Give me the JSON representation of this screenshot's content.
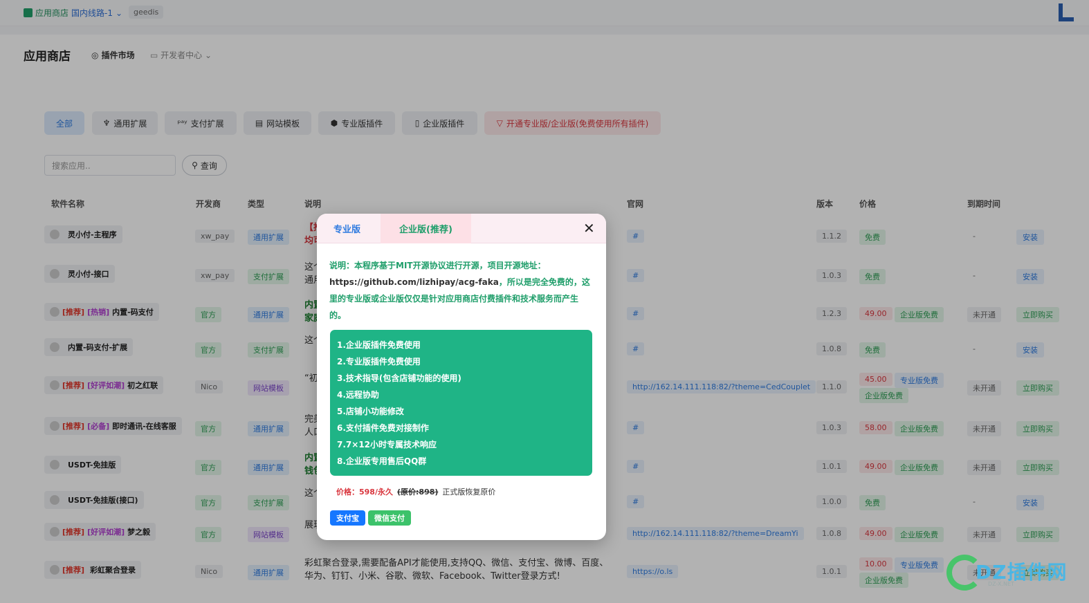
{
  "topbar": {
    "store": "应用商店",
    "route": "国内线路-1",
    "user": "geedis"
  },
  "header": {
    "title": "应用商店",
    "nav_market": "插件市场",
    "nav_dev": "开发者中心"
  },
  "filters": [
    "全部",
    "通用扩展",
    "支付扩展",
    "网站模板",
    "专业版插件",
    "企业版插件",
    "开通专业版/企业版(免费使用所有插件)"
  ],
  "search": {
    "placeholder": "搜索应用..",
    "button": "查询"
  },
  "columns": [
    "软件名称",
    "开发商",
    "类型",
    "说明",
    "官网",
    "版本",
    "价格",
    "到期时间"
  ],
  "rows": [
    {
      "tag1": "",
      "tag2": "",
      "name": "灵小付-主程序",
      "dev": "xw_pay",
      "type": "通用扩展",
      "desc": "【推",
      "desc2": "均可",
      "site": "#",
      "ver": "1.1.2",
      "price": "免费",
      "extra1": "",
      "extra2": "",
      "exp": "-",
      "action": "安装"
    },
    {
      "tag1": "",
      "tag2": "",
      "name": "灵小付-接口",
      "dev": "xw_pay",
      "type": "支付扩展",
      "desc": "这个",
      "desc2": "通用",
      "site": "#",
      "ver": "1.0.3",
      "price": "免费",
      "extra1": "",
      "extra2": "",
      "exp": "-",
      "action": "安装"
    },
    {
      "tag1": "[推荐]",
      "tag2": "[热销]",
      "name": "内置-码支付",
      "dev": "官方",
      "type": "通用扩展",
      "desc": "内置",
      "desc2": "家庭",
      "site": "#",
      "ver": "1.2.3",
      "price": "49.00",
      "extra1": "企业版免费",
      "extra2": "",
      "exp": "未开通",
      "action": "立即购买"
    },
    {
      "tag1": "",
      "tag2": "",
      "name": "内置-码支付-扩展",
      "dev": "官方",
      "type": "支付扩展",
      "desc": "这个",
      "desc2": "",
      "site": "#",
      "ver": "1.0.8",
      "price": "免费",
      "extra1": "",
      "extra2": "",
      "exp": "-",
      "action": "安装"
    },
    {
      "tag1": "[推荐]",
      "tag2": "[好评如潮]",
      "name": "初之红联",
      "dev": "Nico",
      "type": "网站模板",
      "desc": "“初",
      "desc2": "",
      "site": "http://162.14.111.118:82/?theme=CedCouplet",
      "ver": "1.1.0",
      "price": "45.00",
      "extra1": "专业版免费",
      "extra2": "企业版免费",
      "exp": "未开通",
      "action": "立即购买"
    },
    {
      "tag1": "[推荐]",
      "tag2": "[必备]",
      "name": "即时通讯-在线客服",
      "dev": "官方",
      "type": "通用扩展",
      "desc": "完美",
      "desc2": "人口",
      "site": "#",
      "ver": "1.0.3",
      "price": "58.00",
      "extra1": "企业版免费",
      "extra2": "",
      "exp": "未开通",
      "action": "立即购买"
    },
    {
      "tag1": "",
      "tag2": "",
      "name": "USDT-免挂版",
      "dev": "官方",
      "type": "通用扩展",
      "desc": "内置",
      "desc2": "钱包",
      "site": "#",
      "ver": "1.0.1",
      "price": "49.00",
      "extra1": "企业版免费",
      "extra2": "",
      "exp": "未开通",
      "action": "立即购买"
    },
    {
      "tag1": "",
      "tag2": "",
      "name": "USDT-免挂版(接口)",
      "dev": "官方",
      "type": "支付扩展",
      "desc": "这个",
      "desc2": "",
      "site": "#",
      "ver": "1.0.0",
      "price": "免费",
      "extra1": "",
      "extra2": "",
      "exp": "-",
      "action": "安装"
    },
    {
      "tag1": "[推荐]",
      "tag2": "[好评如潮]",
      "name": "梦之毅",
      "dev": "官方",
      "type": "网站模板",
      "desc": "展现",
      "desc2": "",
      "site": "http://162.14.111.118:82/?theme=DreamYi",
      "ver": "1.0.8",
      "price": "49.00",
      "extra1": "企业版免费",
      "extra2": "",
      "exp": "未开通",
      "action": "立即购买"
    },
    {
      "tag1": "[推荐]",
      "tag2": "",
      "name": "彩虹聚合登录",
      "dev": "Nico",
      "type": "通用扩展",
      "desc": "彩虹聚合登录,需要配备API才能使用,支持QQ、微信、支付宝、微博、百度、",
      "desc2": "华为、钉钉、小米、谷歌、微软、Facebook、Twitter登录方式!",
      "site": "https://o.ls",
      "ver": "1.0.1",
      "price": "10.00",
      "extra1": "专业版免费",
      "extra2": "企业版免费",
      "exp": "未开通",
      "action": "立即购买"
    }
  ],
  "modal": {
    "tab_pro": "专业版",
    "tab_ent": "企业版(推荐)",
    "close": "✕",
    "intro_a": "说明：本程序基于MIT开源协议进行开源，项目开源地址：",
    "intro_url": "https://github.com/lizhipay/acg-faka",
    "intro_b": "，所以是完全免费的，这里的专业版或企业版仅仅是针对应用商店付费插件和技术服务而产生的。",
    "features": [
      "1.企业版插件免费使用",
      "2.专业版插件免费使用",
      "3.技术指导(包含店铺功能的使用)",
      "4.远程协助",
      "5.店铺小功能修改",
      "6.支付插件免费对接制作",
      "7.7×12小时专属技术响应",
      "8.企业版专用售后QQ群"
    ],
    "price_now": "价格：598/永久",
    "price_old": "(原价:898)",
    "price_note": "正式版恢复原价",
    "pay_alipay": "支付宝",
    "pay_wechat": "微信支付"
  },
  "watermark": {
    "text": "DZ插件网",
    "sub": "DZ-X.NET"
  },
  "colors": {
    "accent": "#2f7be0",
    "green": "#1fb486",
    "red": "#d9363e"
  }
}
